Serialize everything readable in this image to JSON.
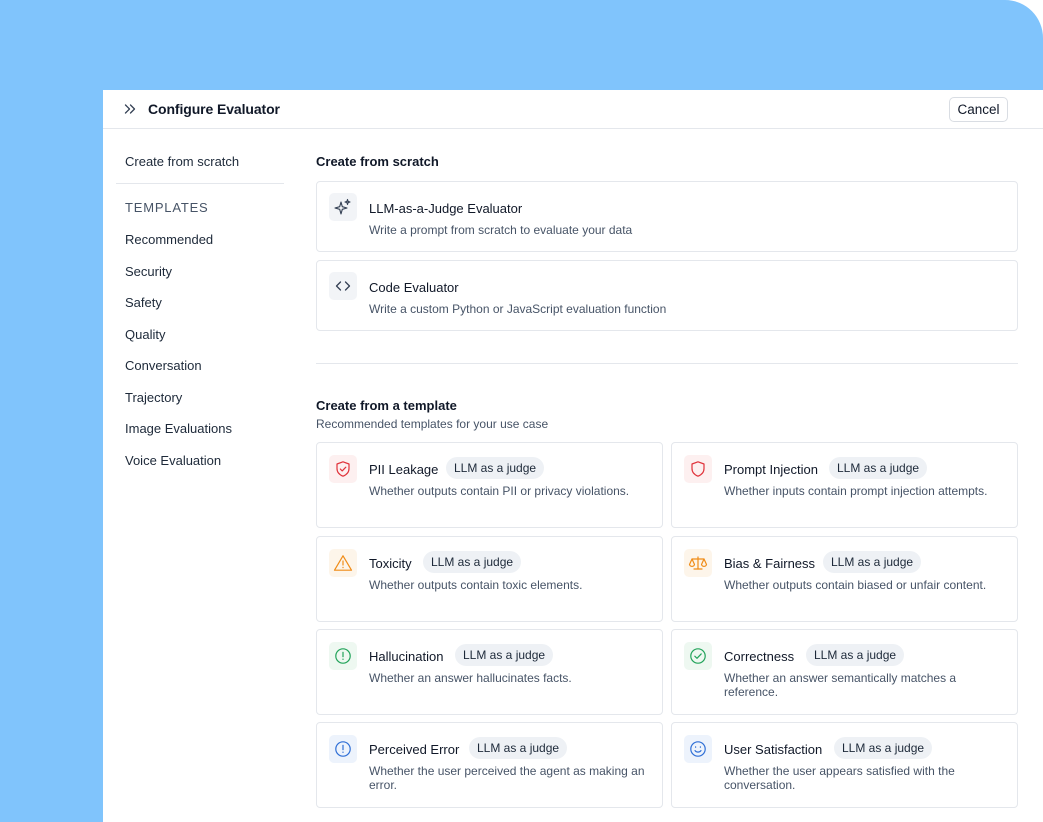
{
  "header": {
    "title": "Configure Evaluator",
    "cancel_label": "Cancel"
  },
  "sidebar": {
    "top_link": "Create from scratch",
    "section_label": "TEMPLATES",
    "items": [
      "Recommended",
      "Security",
      "Safety",
      "Quality",
      "Conversation",
      "Trajectory",
      "Image Evaluations",
      "Voice Evaluation"
    ]
  },
  "main": {
    "scratch": {
      "title": "Create from scratch",
      "cards": [
        {
          "title": "LLM-as-a-Judge Evaluator",
          "description": "Write a prompt from scratch to evaluate your data",
          "icon": "sparkles-icon"
        },
        {
          "title": "Code Evaluator",
          "description": "Write a custom Python or JavaScript evaluation function",
          "icon": "code-icon"
        }
      ]
    },
    "template": {
      "title": "Create from a template",
      "subtitle": "Recommended templates for your use case",
      "cards": [
        {
          "title": "PII Leakage",
          "badge": "LLM as a judge",
          "description": "Whether outputs contain PII or privacy violations.",
          "icon": "shield-check-icon",
          "icon_color": "#e0333b",
          "icon_bg": "#fdf0f0"
        },
        {
          "title": "Prompt Injection",
          "badge": "LLM as a judge",
          "description": "Whether inputs contain prompt injection attempts.",
          "icon": "shield-icon",
          "icon_color": "#e0333b",
          "icon_bg": "#fdf0f0"
        },
        {
          "title": "Toxicity",
          "badge": "LLM as a judge",
          "description": "Whether outputs contain toxic elements.",
          "icon": "warning-triangle-icon",
          "icon_color": "#f08c18",
          "icon_bg": "#fdf5ea"
        },
        {
          "title": "Bias & Fairness",
          "badge": "LLM as a judge",
          "description": "Whether outputs contain biased or unfair content.",
          "icon": "scales-icon",
          "icon_color": "#f08c18",
          "icon_bg": "#fdf5ea"
        },
        {
          "title": "Hallucination",
          "badge": "LLM as a judge",
          "description": "Whether an answer hallucinates facts.",
          "icon": "alert-circle-icon",
          "icon_color": "#22a35a",
          "icon_bg": "#eef8f1"
        },
        {
          "title": "Correctness",
          "badge": "LLM as a judge",
          "description": "Whether an answer semantically matches a reference.",
          "icon": "check-circle-icon",
          "icon_color": "#22a35a",
          "icon_bg": "#eef8f1"
        },
        {
          "title": "Perceived Error",
          "badge": "LLM as a judge",
          "description": "Whether the user perceived the agent as making an error.",
          "icon": "info-circle-icon",
          "icon_color": "#2f6fd6",
          "icon_bg": "#edf3fc"
        },
        {
          "title": "User Satisfaction",
          "badge": "LLM as a judge",
          "description": "Whether the user appears satisfied with the conversation.",
          "icon": "smile-icon",
          "icon_color": "#2f6fd6",
          "icon_bg": "#edf3fc"
        }
      ]
    }
  },
  "colors": {
    "backdrop": "#80c4fc",
    "border": "#e4e7ec",
    "badge_bg": "#eef1f5"
  }
}
